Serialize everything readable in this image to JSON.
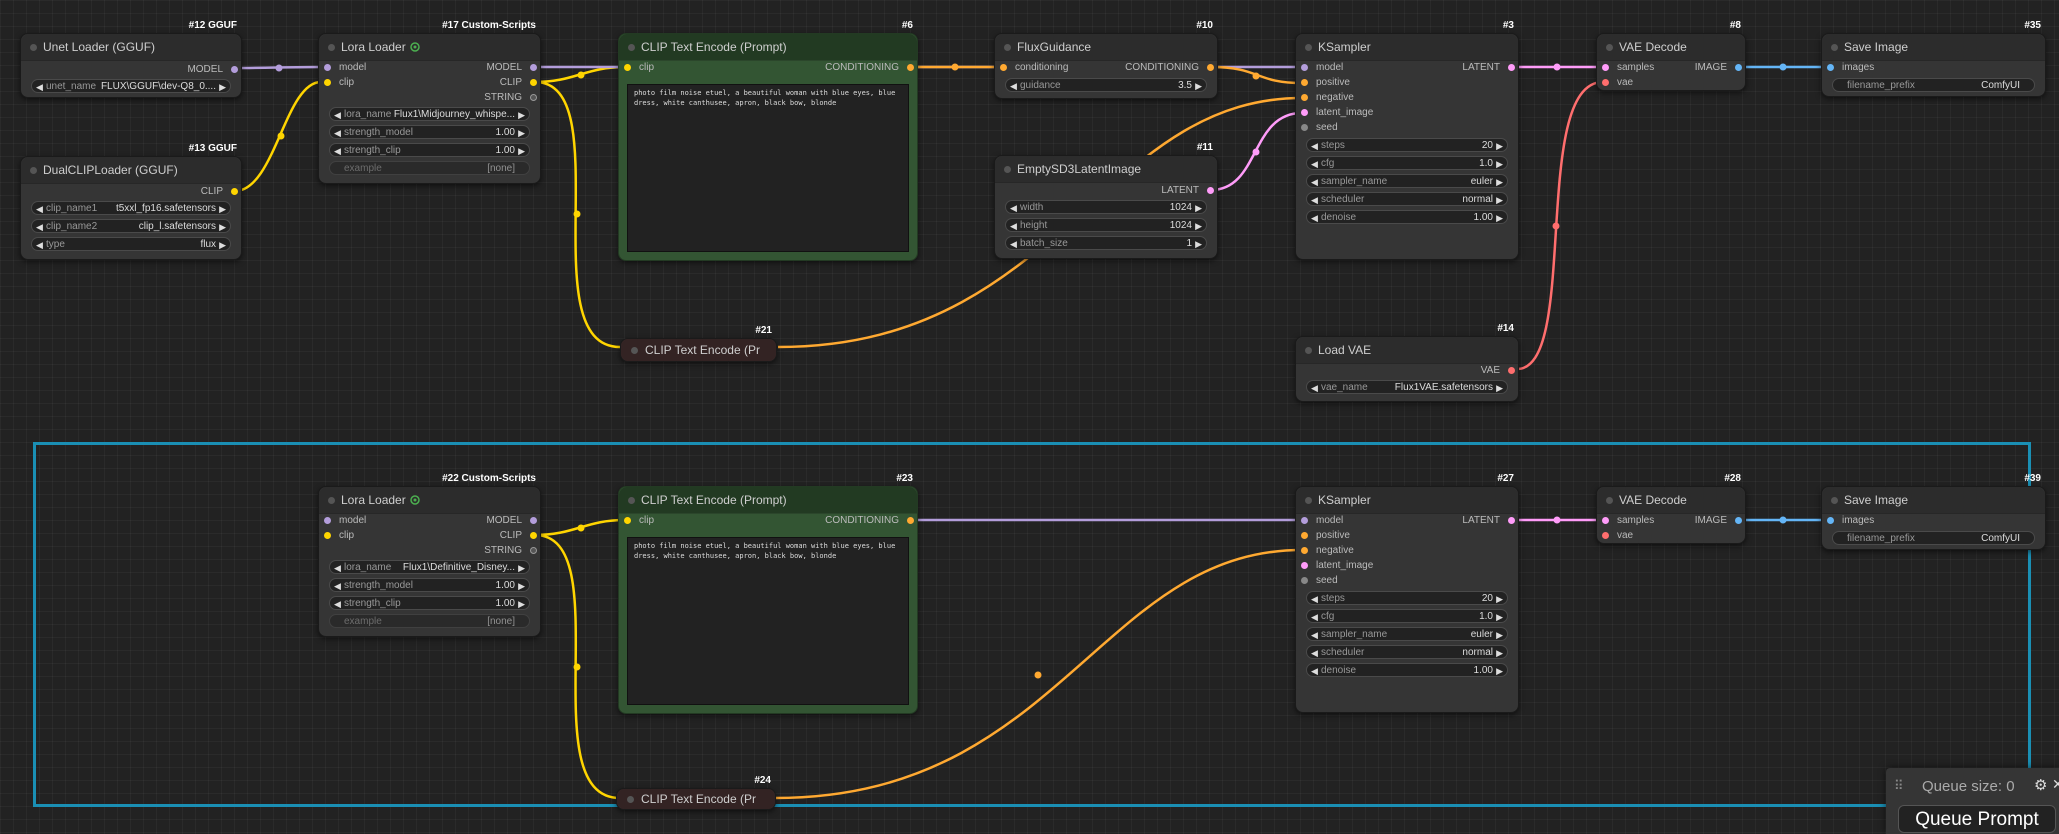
{
  "colors": {
    "model": "#b39ddb",
    "clip": "#ffd500",
    "conditioning": "#ffa931",
    "latent": "#ff9cf9",
    "vae": "#ff6e6e",
    "image": "#64b5f6",
    "string": "#888888",
    "int": "#888888",
    "group_border": "#1a8fb4",
    "node_green": "#335533",
    "node_wine": "#3a2828"
  },
  "icons": {
    "lora": "lora-icon",
    "gear": "gear-icon",
    "close": "close-icon",
    "drag": "drag-handle-icon"
  },
  "nodes": {
    "n12": {
      "badge": "#12 GGUF",
      "title": "Unet Loader (GGUF)",
      "out_model": "MODEL",
      "w_unet_label": "unet_name",
      "w_unet_value": "FLUX\\GGUF\\dev-Q8_0...."
    },
    "n13": {
      "badge": "#13 GGUF",
      "title": "DualCLIPLoader (GGUF)",
      "out_clip": "CLIP",
      "w1_label": "clip_name1",
      "w1_value": "t5xxl_fp16.safetensors",
      "w2_label": "clip_name2",
      "w2_value": "clip_l.safetensors",
      "w3_label": "type",
      "w3_value": "flux"
    },
    "n17": {
      "badge": "#17 Custom-Scripts",
      "title": "Lora Loader",
      "in_model": "model",
      "in_clip": "clip",
      "out_model": "MODEL",
      "out_clip": "CLIP",
      "out_string": "STRING",
      "w1_label": "lora_name",
      "w1_value": "Flux1\\Midjourney_whispe...",
      "w2_label": "strength_model",
      "w2_value": "1.00",
      "w3_label": "strength_clip",
      "w3_value": "1.00",
      "w4_label": "example",
      "w4_value": "[none]"
    },
    "n6": {
      "badge": "#6",
      "title": "CLIP Text Encode (Prompt)",
      "in_clip": "clip",
      "out_cond": "CONDITIONING",
      "text": "photo film noise etuel, a beautiful woman with blue eyes, blue dress, white canthusee, apron, black bow, blonde"
    },
    "n10": {
      "badge": "#10",
      "title": "FluxGuidance",
      "in_cond": "conditioning",
      "out_cond": "CONDITIONING",
      "w1_label": "guidance",
      "w1_value": "3.5"
    },
    "n11": {
      "badge": "#11",
      "title": "EmptySD3LatentImage",
      "out_latent": "LATENT",
      "w1_label": "width",
      "w1_value": "1024",
      "w2_label": "height",
      "w2_value": "1024",
      "w3_label": "batch_size",
      "w3_value": "1"
    },
    "n3": {
      "badge": "#3",
      "title": "KSampler",
      "in_model": "model",
      "in_positive": "positive",
      "in_negative": "negative",
      "in_latent": "latent_image",
      "in_seed": "seed",
      "out_latent": "LATENT",
      "w1_label": "steps",
      "w1_value": "20",
      "w2_label": "cfg",
      "w2_value": "1.0",
      "w3_label": "sampler_name",
      "w3_value": "euler",
      "w4_label": "scheduler",
      "w4_value": "normal",
      "w5_label": "denoise",
      "w5_value": "1.00"
    },
    "n8": {
      "badge": "#8",
      "title": "VAE Decode",
      "in_samples": "samples",
      "in_vae": "vae",
      "out_image": "IMAGE"
    },
    "n35": {
      "badge": "#35",
      "title": "Save Image",
      "in_images": "images",
      "w1_label": "filename_prefix",
      "w1_value": "ComfyUI"
    },
    "n21": {
      "badge": "#21",
      "title": "CLIP Text Encode (Pr"
    },
    "n14": {
      "badge": "#14",
      "title": "Load VAE",
      "out_vae": "VAE",
      "w1_label": "vae_name",
      "w1_value": "Flux1VAE.safetensors"
    },
    "n22": {
      "badge": "#22 Custom-Scripts",
      "title": "Lora Loader",
      "in_model": "model",
      "in_clip": "clip",
      "out_model": "MODEL",
      "out_clip": "CLIP",
      "out_string": "STRING",
      "w1_label": "lora_name",
      "w1_value": "Flux1\\Definitive_Disney...",
      "w2_label": "strength_model",
      "w2_value": "1.00",
      "w3_label": "strength_clip",
      "w3_value": "1.00",
      "w4_label": "example",
      "w4_value": "[none]"
    },
    "n23": {
      "badge": "#23",
      "title": "CLIP Text Encode (Prompt)",
      "in_clip": "clip",
      "out_cond": "CONDITIONING",
      "text": "photo film noise etuel, a beautiful woman with blue eyes, blue dress, white canthusee, apron, black bow, blonde"
    },
    "n27": {
      "badge": "#27",
      "title": "KSampler",
      "in_model": "model",
      "in_positive": "positive",
      "in_negative": "negative",
      "in_latent": "latent_image",
      "in_seed": "seed",
      "out_latent": "LATENT",
      "w1_label": "steps",
      "w1_value": "20",
      "w2_label": "cfg",
      "w2_value": "1.0",
      "w3_label": "sampler_name",
      "w3_value": "euler",
      "w4_label": "scheduler",
      "w4_value": "normal",
      "w5_label": "denoise",
      "w5_value": "1.00"
    },
    "n28": {
      "badge": "#28",
      "title": "VAE Decode",
      "in_samples": "samples",
      "in_vae": "vae",
      "out_image": "IMAGE"
    },
    "n39": {
      "badge": "#39",
      "title": "Save Image",
      "in_images": "images",
      "w1_label": "filename_prefix",
      "w1_value": "ComfyUI"
    },
    "n24": {
      "badge": "#24",
      "title": "CLIP Text Encode (Pr"
    }
  },
  "queue": {
    "size_text": "Queue size: 0",
    "button_label": "Queue Prompt"
  }
}
